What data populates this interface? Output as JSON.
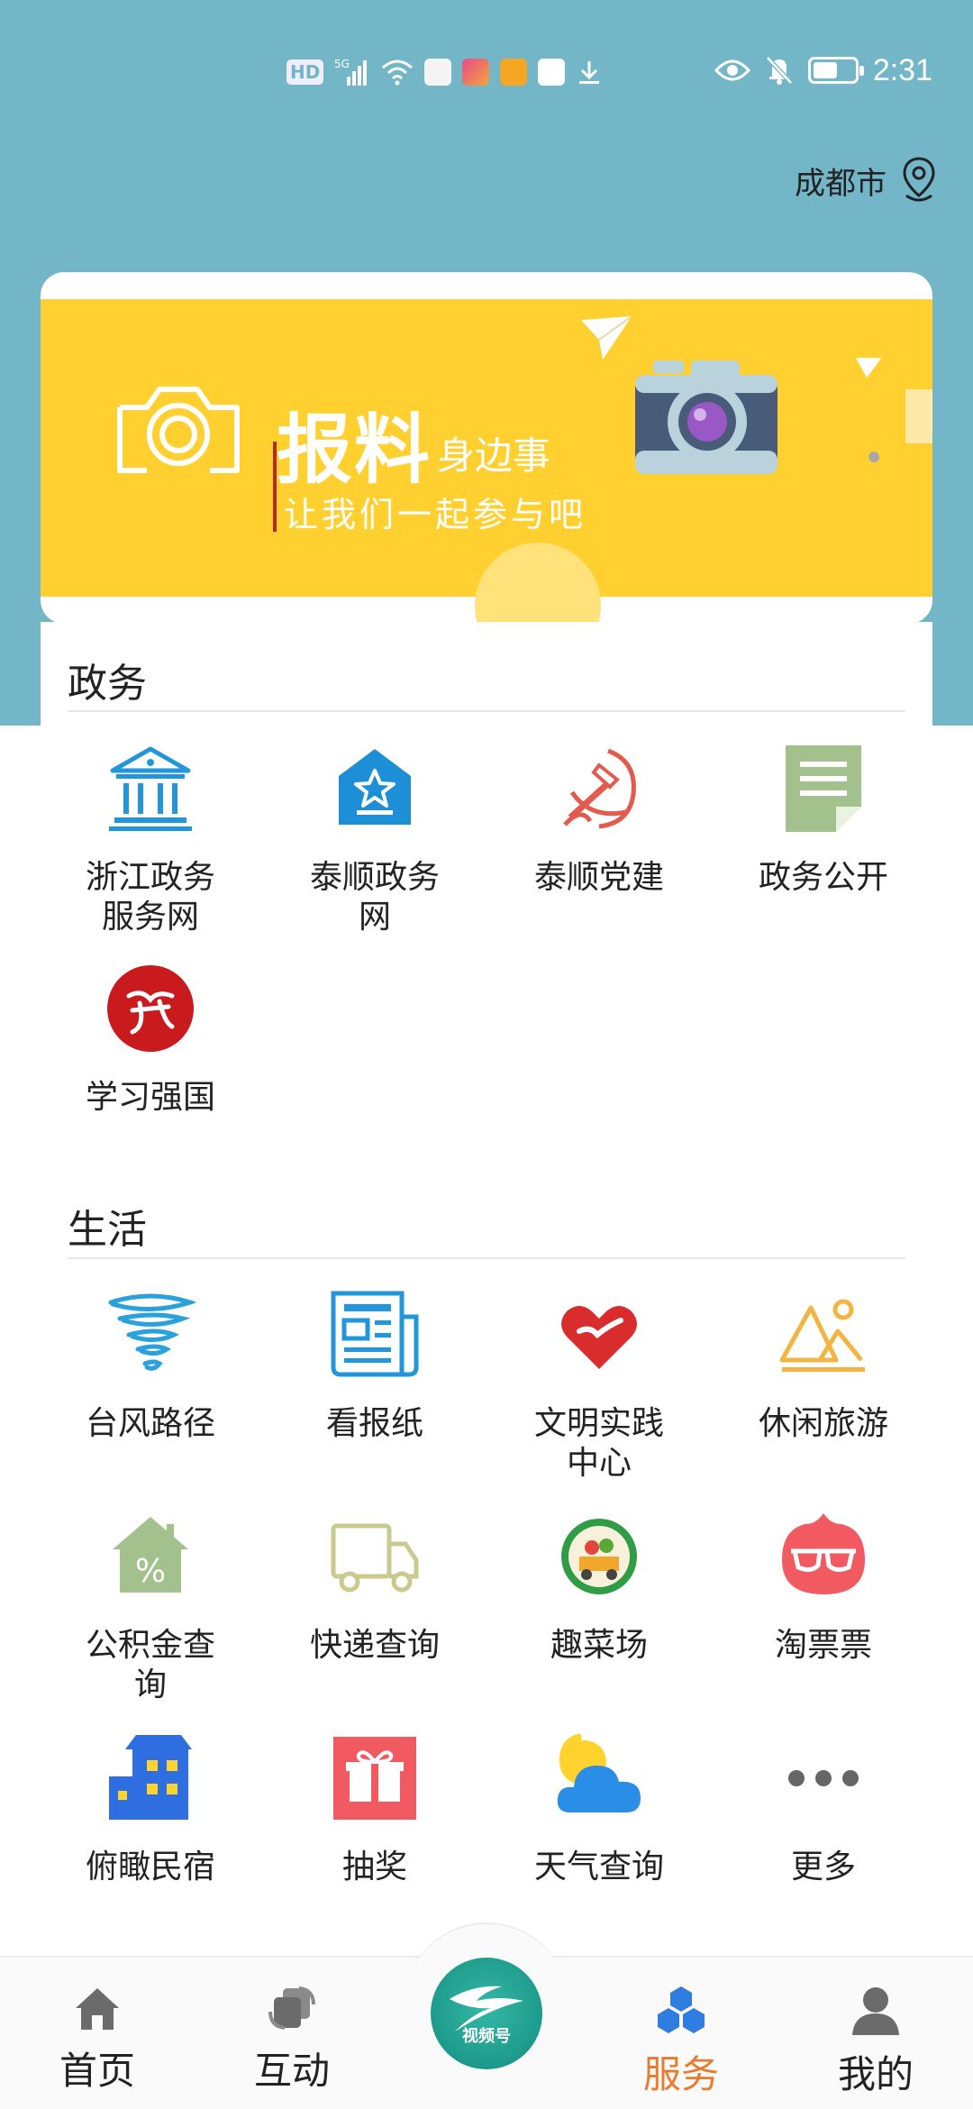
{
  "status_bar": {
    "time": "2:31",
    "left_icons": [
      "hd-icon",
      "5g-signal-icon",
      "wifi-icon",
      "huawei-app-icon",
      "app-icon",
      "cup-app-icon",
      "upload-icon",
      "download-icon"
    ],
    "right_icons": [
      "eye-icon",
      "mute-icon",
      "battery-icon"
    ],
    "network_label": "HD",
    "battery_level": 0.6
  },
  "location": {
    "city": "成都市"
  },
  "banner": {
    "title": "报料",
    "subtitle": "身边事",
    "tagline": "让我们一起参与吧"
  },
  "sections": {
    "gov": {
      "title": "政务",
      "items": [
        {
          "label": "浙江政务服务网",
          "icon": "government-building-icon"
        },
        {
          "label": "泰顺政务网",
          "icon": "star-house-icon"
        },
        {
          "label": "泰顺党建",
          "icon": "party-emblem-icon"
        },
        {
          "label": "政务公开",
          "icon": "document-icon"
        },
        {
          "label": "学习强国",
          "icon": "xuexi-logo-icon"
        }
      ]
    },
    "life": {
      "title": "生活",
      "items": [
        {
          "label": "台风路径",
          "icon": "typhoon-icon"
        },
        {
          "label": "看报纸",
          "icon": "newspaper-icon"
        },
        {
          "label": "文明实践中心",
          "icon": "heart-hand-icon"
        },
        {
          "label": "休闲旅游",
          "icon": "mountain-icon"
        },
        {
          "label": "公积金查询",
          "icon": "house-percent-icon"
        },
        {
          "label": "快递查询",
          "icon": "delivery-truck-icon"
        },
        {
          "label": "趣菜场",
          "icon": "vegetable-market-icon"
        },
        {
          "label": "淘票票",
          "icon": "glasses-icon"
        },
        {
          "label": "俯瞰民宿",
          "icon": "homestay-building-icon"
        },
        {
          "label": "抽奖",
          "icon": "gift-icon"
        },
        {
          "label": "天气查询",
          "icon": "weather-icon"
        },
        {
          "label": "更多",
          "icon": "more-icon"
        }
      ]
    }
  },
  "bottom_nav": {
    "items": [
      {
        "label": "首页",
        "icon": "home-icon"
      },
      {
        "label": "互动",
        "icon": "interact-icon"
      },
      {
        "label": "服务",
        "icon": "service-icon",
        "active": true
      },
      {
        "label": "我的",
        "icon": "user-icon"
      }
    ],
    "center_label": "视频号",
    "active_color": "#ea7a2e"
  },
  "colors": {
    "hero_bg": "#72b6c8",
    "banner_bg": "#ffd02f"
  }
}
